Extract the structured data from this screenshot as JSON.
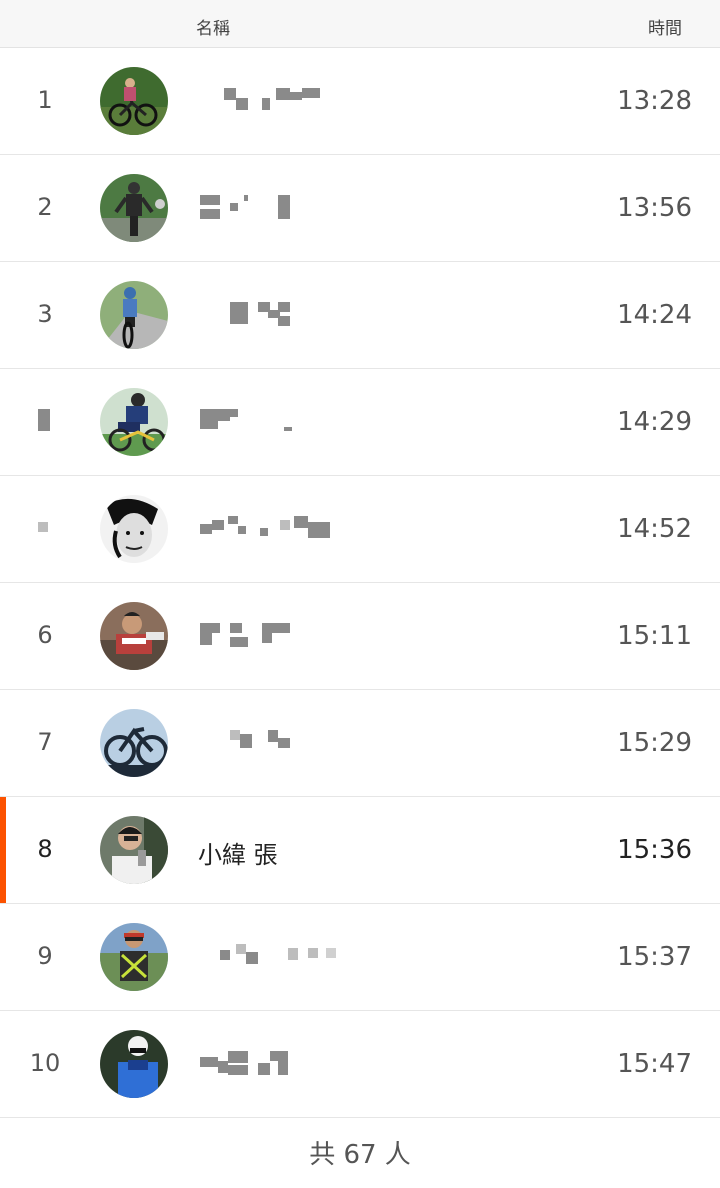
{
  "header": {
    "name_label": "名稱",
    "time_label": "時間"
  },
  "rows": [
    {
      "rank": "1",
      "name": "",
      "time": "13:28",
      "avatar_icon": "cyclist-avatar-icon"
    },
    {
      "rank": "2",
      "name": "",
      "time": "13:56",
      "avatar_icon": "cyclist-avatar-icon"
    },
    {
      "rank": "3",
      "name": "",
      "time": "14:24",
      "avatar_icon": "cyclist-avatar-icon"
    },
    {
      "rank": "",
      "name": "",
      "time": "14:29",
      "avatar_icon": "cyclist-avatar-icon"
    },
    {
      "rank": "",
      "name": "",
      "time": "14:52",
      "avatar_icon": "portrait-avatar-icon"
    },
    {
      "rank": "6",
      "name": "",
      "time": "15:11",
      "avatar_icon": "cyclist-avatar-icon"
    },
    {
      "rank": "7",
      "name": "",
      "time": "15:29",
      "avatar_icon": "bicycle-avatar-icon"
    },
    {
      "rank": "8",
      "name": "小緯 張",
      "time": "15:36",
      "avatar_icon": "selfie-avatar-icon",
      "highlight": true
    },
    {
      "rank": "9",
      "name": "",
      "time": "15:37",
      "avatar_icon": "cyclist-avatar-icon"
    },
    {
      "rank": "10",
      "name": "",
      "time": "15:47",
      "avatar_icon": "cyclist-avatar-icon"
    }
  ],
  "footer": {
    "total_label": "共 67 人"
  },
  "colors": {
    "accent": "#fc5200"
  }
}
